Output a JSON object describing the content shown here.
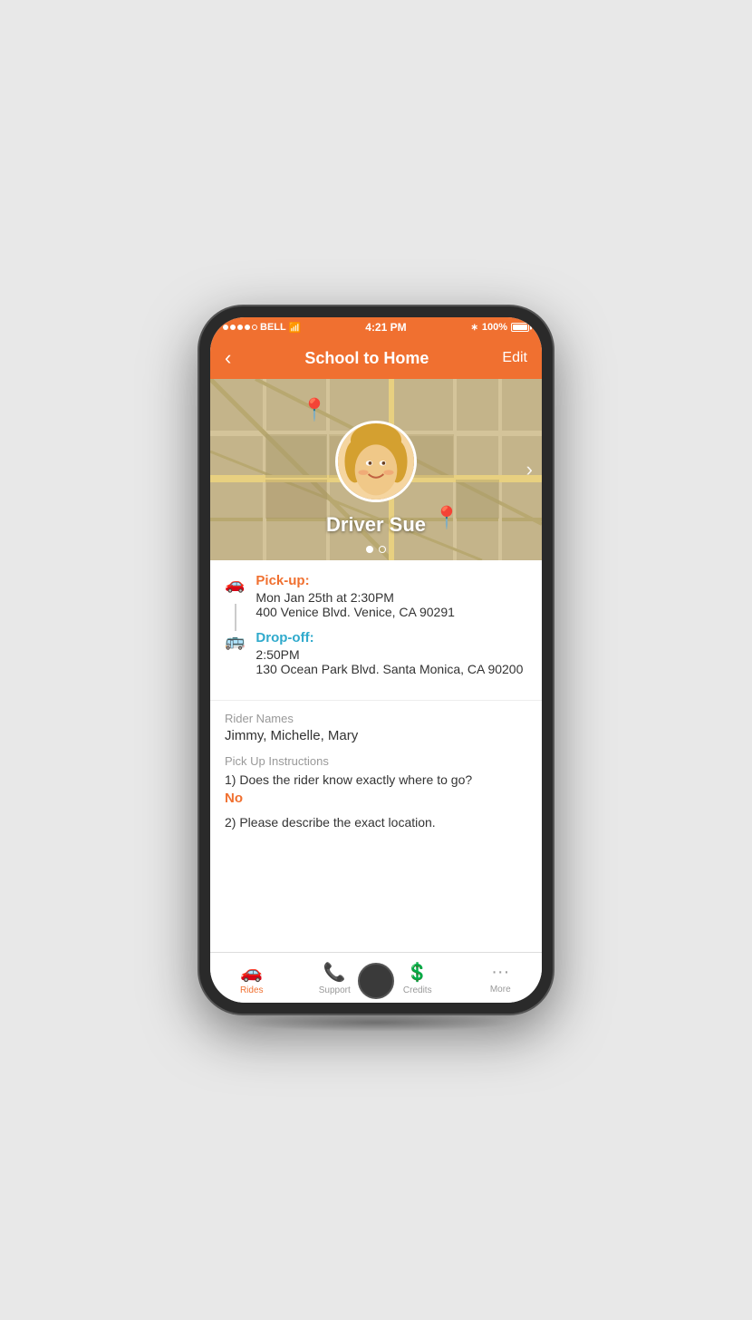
{
  "status_bar": {
    "carrier": "BELL",
    "time": "4:21 PM",
    "battery": "100%"
  },
  "nav": {
    "back_label": "‹",
    "title": "School to Home",
    "edit_label": "Edit"
  },
  "driver": {
    "name": "Driver Sue"
  },
  "pickup": {
    "label": "Pick-up:",
    "time": "Mon Jan 25th at 2:30PM",
    "address": "400 Venice Blvd. Venice, CA 90291"
  },
  "dropoff": {
    "label": "Drop-off:",
    "time": "2:50PM",
    "address": "130 Ocean Park Blvd. Santa Monica, CA 90200"
  },
  "riders": {
    "section_label": "Rider Names",
    "names": "Jimmy, Michelle, Mary"
  },
  "instructions": {
    "section_label": "Pick Up Instructions",
    "question1": "1) Does the rider know exactly where to go?",
    "answer1": "No",
    "question2": "2) Please describe the exact location."
  },
  "tabs": {
    "rides_label": "Rides",
    "support_label": "Support",
    "credits_label": "Credits",
    "more_label": "More"
  }
}
